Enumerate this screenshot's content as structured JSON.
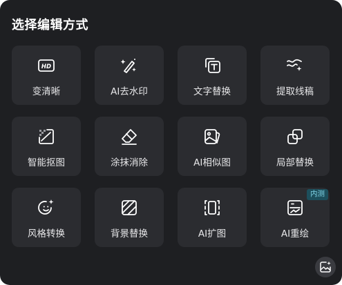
{
  "panel": {
    "title": "选择编辑方式"
  },
  "tools": [
    {
      "label": "变清晰",
      "icon": "hd-icon"
    },
    {
      "label": "AI去水印",
      "icon": "magic-wand-icon"
    },
    {
      "label": "文字替换",
      "icon": "text-replace-icon"
    },
    {
      "label": "提取线稿",
      "icon": "line-art-icon"
    },
    {
      "label": "智能抠图",
      "icon": "smart-cutout-icon"
    },
    {
      "label": "涂抹消除",
      "icon": "eraser-icon"
    },
    {
      "label": "AI相似图",
      "icon": "similar-image-icon"
    },
    {
      "label": "局部替换",
      "icon": "partial-replace-icon"
    },
    {
      "label": "风格转换",
      "icon": "style-transfer-icon"
    },
    {
      "label": "背景替换",
      "icon": "background-replace-icon"
    },
    {
      "label": "AI扩图",
      "icon": "expand-image-icon"
    },
    {
      "label": "AI重绘",
      "icon": "redraw-icon",
      "badge": "内测"
    }
  ],
  "fab": {
    "icon": "image-ai-icon"
  },
  "colors": {
    "panel_bg": "#1e1f22",
    "tile_bg": "#2b2c30",
    "text": "#e6e6e8",
    "badge_bg": "#1d4f5c",
    "badge_text": "#7fd3e6"
  }
}
